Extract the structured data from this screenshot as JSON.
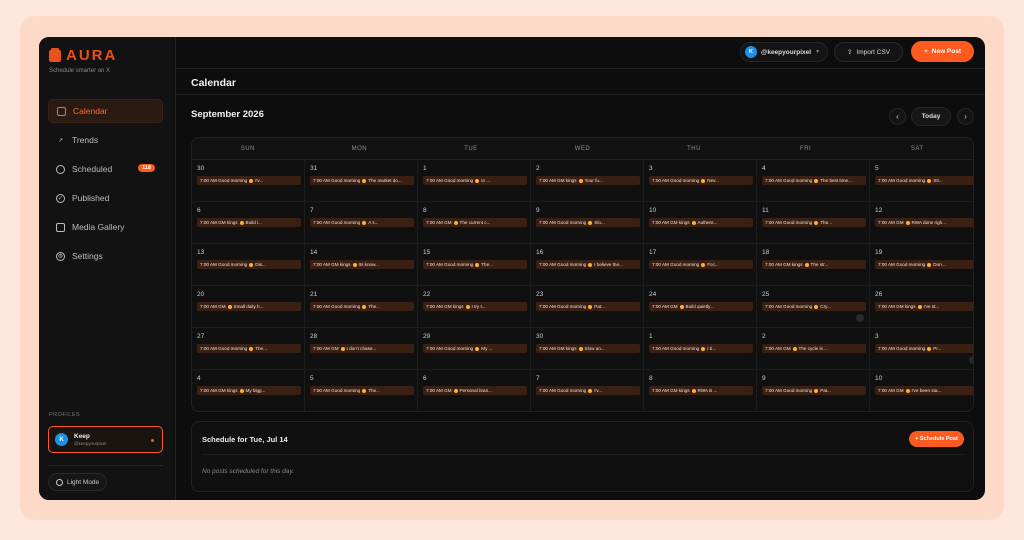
{
  "brand": {
    "name": "AURA",
    "tagline": "Schedule smarter on X",
    "accent": "#ff5a1f"
  },
  "sidebar": {
    "items": [
      {
        "label": "Calendar",
        "icon": "calendar-icon",
        "active": true
      },
      {
        "label": "Trends",
        "icon": "trend-icon"
      },
      {
        "label": "Scheduled",
        "icon": "clock-icon",
        "badge": "118"
      },
      {
        "label": "Published",
        "icon": "check-circle-icon"
      },
      {
        "label": "Media Gallery",
        "icon": "image-icon"
      },
      {
        "label": "Settings",
        "icon": "gear-icon"
      }
    ],
    "profiles_label": "PROFILES",
    "profile": {
      "initial": "K",
      "name": "Keep",
      "handle": "@keepyourpixel"
    },
    "light_mode_label": "Light Mode"
  },
  "topbar": {
    "account": {
      "initial": "K",
      "handle": "@keepyourpixel"
    },
    "import_label": "Import CSV",
    "new_post_label": "New Post"
  },
  "page": {
    "title": "Calendar",
    "month": "September 2026",
    "today_label": "Today",
    "prev_icon": "chevron-left-icon",
    "next_icon": "chevron-right-icon"
  },
  "calendar": {
    "weekdays": [
      "SUN",
      "MON",
      "TUE",
      "WED",
      "THU",
      "FRI",
      "SAT"
    ],
    "weeks": [
      [
        {
          "day": "30",
          "post": "7:00 AM Good morning",
          "snippet": "I'v..."
        },
        {
          "day": "31",
          "post": "7:00 AM Good morning",
          "snippet": "The market do..."
        },
        {
          "day": "1",
          "post": "7:00 AM Good morning",
          "snippet": "In ..."
        },
        {
          "day": "2",
          "post": "7:00 AM GM kings",
          "snippet": "Your fu..."
        },
        {
          "day": "3",
          "post": "7:00 AM Good morning",
          "snippet": "Nev..."
        },
        {
          "day": "4",
          "post": "7:00 AM Good morning",
          "snippet": "The best time..."
        },
        {
          "day": "5",
          "post": "7:00 AM Good morning",
          "snippet": "Str..."
        }
      ],
      [
        {
          "day": "6",
          "post": "7:00 AM GM kings",
          "snippet": "Build i..."
        },
        {
          "day": "7",
          "post": "7:00 AM Good morning",
          "snippet": "A s..."
        },
        {
          "day": "8",
          "post": "7:00 AM GM",
          "snippet": "The current c..."
        },
        {
          "day": "9",
          "post": "7:00 AM Good morning",
          "snippet": "Slo..."
        },
        {
          "day": "10",
          "post": "7:00 AM GM kings",
          "snippet": "Authent..."
        },
        {
          "day": "11",
          "post": "7:00 AM Good morning",
          "snippet": "The..."
        },
        {
          "day": "12",
          "post": "7:00 AM GM",
          "snippet": "RWA done righ..."
        }
      ],
      [
        {
          "day": "13",
          "post": "7:00 AM Good morning",
          "snippet": "Dis..."
        },
        {
          "day": "14",
          "post": "7:00 AM GM kings",
          "snippet": "Its know..."
        },
        {
          "day": "15",
          "post": "7:00 AM Good morning",
          "snippet": "The..."
        },
        {
          "day": "16",
          "post": "7:00 AM Good morning",
          "snippet": "I believe the..."
        },
        {
          "day": "17",
          "post": "7:00 AM Good morning",
          "snippet": "Foc..."
        },
        {
          "day": "18",
          "post": "7:00 AM GM kings",
          "snippet": "The str..."
        },
        {
          "day": "19",
          "post": "7:00 AM Good morning",
          "snippet": "Don..."
        }
      ],
      [
        {
          "day": "20",
          "post": "7:00 AM GM",
          "snippet": "Small daily h..."
        },
        {
          "day": "21",
          "post": "7:00 AM Good morning",
          "snippet": "The..."
        },
        {
          "day": "22",
          "post": "7:00 AM GM kings",
          "snippet": "I try t..."
        },
        {
          "day": "23",
          "post": "7:00 AM Good morning",
          "snippet": "Pat..."
        },
        {
          "day": "24",
          "post": "7:00 AM GM",
          "snippet": "Build quietly..."
        },
        {
          "day": "25",
          "post": "7:00 AM Good morning",
          "snippet": "Cry...",
          "more": true
        },
        {
          "day": "26",
          "post": "7:00 AM GM kings",
          "snippet": "I've st..."
        }
      ],
      [
        {
          "day": "27",
          "post": "7:00 AM Good morning",
          "snippet": "The..."
        },
        {
          "day": "28",
          "post": "7:00 AM GM",
          "snippet": "I don't chase..."
        },
        {
          "day": "29",
          "post": "7:00 AM Good morning",
          "snippet": "My ..."
        },
        {
          "day": "30",
          "post": "7:00 AM GM kings",
          "snippet": "Slow an..."
        },
        {
          "day": "1",
          "post": "7:00 AM Good morning",
          "snippet": "I b..."
        },
        {
          "day": "2",
          "post": "7:00 AM GM",
          "snippet": "The cycle is ..."
        },
        {
          "day": "3",
          "post": "7:00 AM Good morning",
          "snippet": "Pr...",
          "more": true
        }
      ],
      [
        {
          "day": "4",
          "post": "7:00 AM GM kings",
          "snippet": "My bigg..."
        },
        {
          "day": "5",
          "post": "7:00 AM Good morning",
          "snippet": "The..."
        },
        {
          "day": "6",
          "post": "7:00 AM GM",
          "snippet": "Personal bran..."
        },
        {
          "day": "7",
          "post": "7:00 AM Good morning",
          "snippet": "I'v..."
        },
        {
          "day": "8",
          "post": "7:00 AM GM kings",
          "snippet": "RWA is ..."
        },
        {
          "day": "9",
          "post": "7:00 AM Good morning",
          "snippet": "Pat..."
        },
        {
          "day": "10",
          "post": "7:00 AM GM",
          "snippet": "I've been sta..."
        }
      ]
    ]
  },
  "schedule": {
    "title": "Schedule for Tue, Jul 14",
    "button_label": "+ Schedule Post",
    "empty_text": "No posts scheduled for this day."
  }
}
